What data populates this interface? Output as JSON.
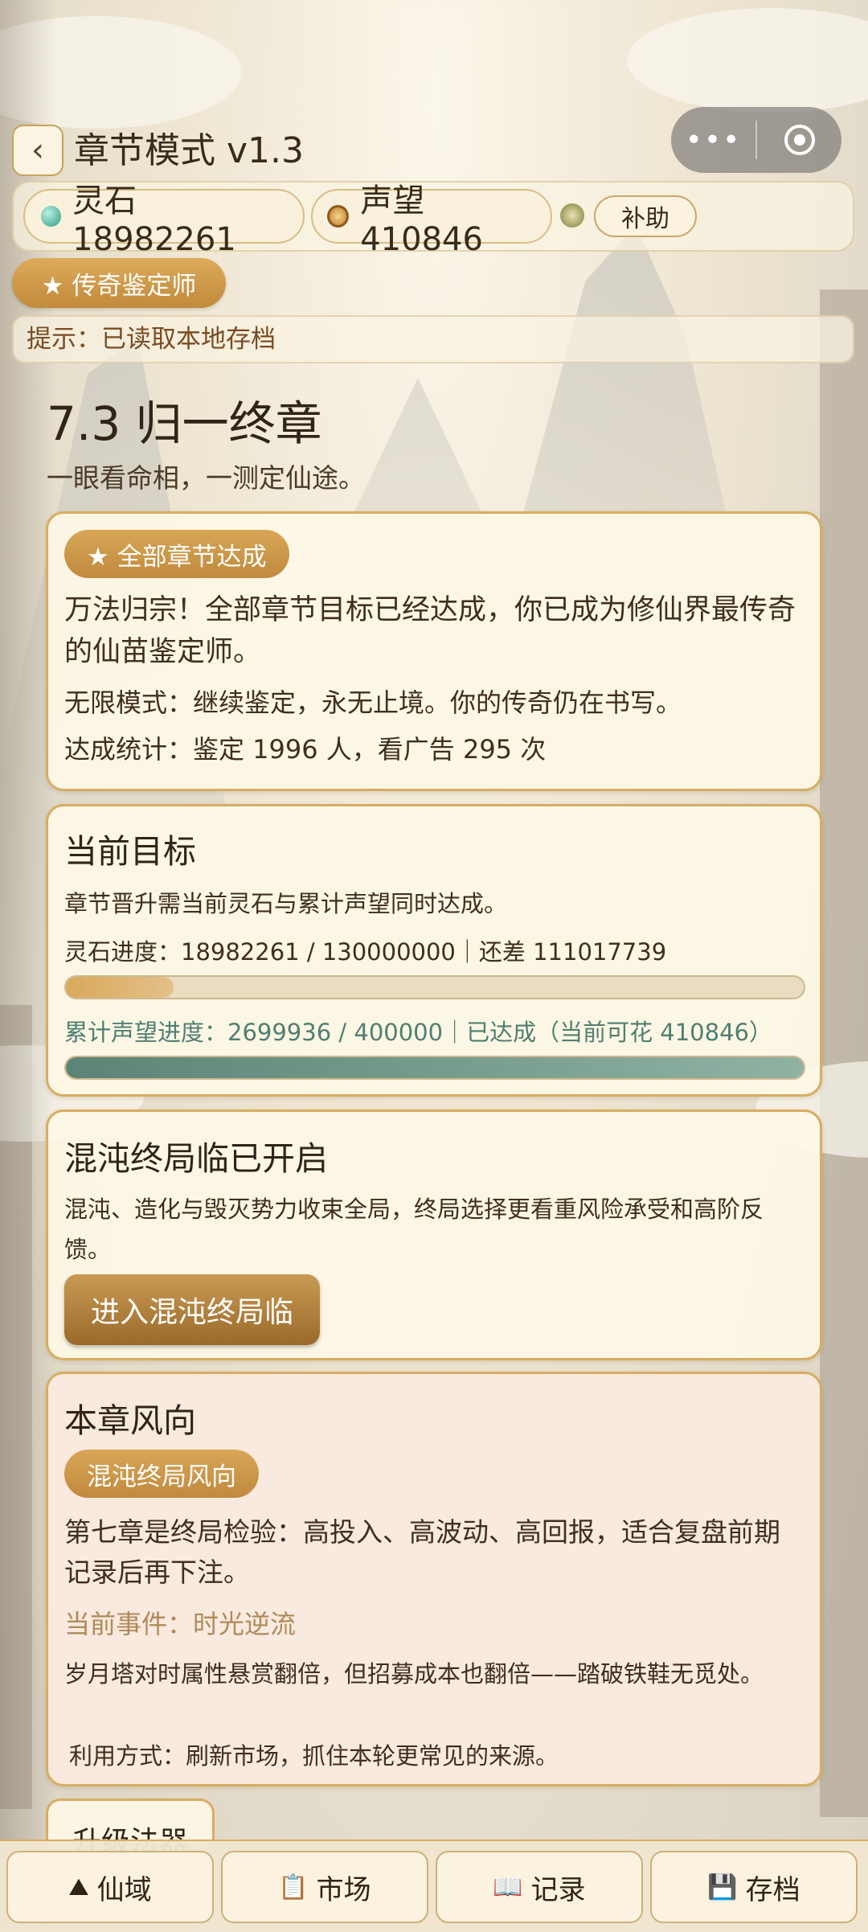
{
  "header": {
    "back_icon": "‹",
    "title": "章节模式 v1.3",
    "menu_dots": "•••"
  },
  "resources": {
    "spirit_stone": "灵石 18982261",
    "prestige": "声望 410846",
    "assist_label": "补助"
  },
  "title_badge": "★ 传奇鉴定师",
  "tip": "提示：已读取本地存档",
  "chapter": {
    "title": "7.3 归一终章",
    "subtitle": "一眼看命相，一测定仙途。"
  },
  "achievement_card": {
    "badge": "★ 全部章节达成",
    "main_text": "万法归宗！全部章节目标已经达成，你已成为修仙界最传奇的仙苗鉴定师。",
    "infinite_mode": "无限模式：继续鉴定，永无止境。你的传奇仍在书写。",
    "stats": "达成统计：鉴定 1996 人，看广告 295 次"
  },
  "goal_card": {
    "heading": "当前目标",
    "desc": "章节晋升需当前灵石与累计声望同时达成。",
    "stone_progress_text": "灵石进度：18982261 / 130000000｜还差 111017739",
    "stone_progress_value": 0.146,
    "prestige_progress_text": "累计声望进度：2699936 / 400000｜已达成（当前可花 410846）",
    "prestige_progress_value": 1.0
  },
  "chaos_card": {
    "heading": "混沌终局临已开启",
    "desc": "混沌、造化与毁灭势力收束全局，终局选择更看重风险承受和高阶反馈。",
    "button": "进入混沌终局临"
  },
  "trend_card": {
    "heading": "本章风向",
    "badge": "混沌终局风向",
    "desc": "第七章是终局检验：高投入、高波动、高回报，适合复盘前期记录后再下注。",
    "event": "当前事件：时光逆流",
    "event_desc": "岁月塔对时属性悬赏翻倍，但招募成本也翻倍——踏破铁鞋无觅处。",
    "usage": "利用方式：刷新市场，抓住本轮更常见的来源。"
  },
  "next_section_peek": "升级法器",
  "bottom_nav": [
    {
      "icon": "mountain-icon",
      "glyph": "⛰",
      "label": "仙域"
    },
    {
      "icon": "clipboard-icon",
      "glyph": "📋",
      "label": "市场"
    },
    {
      "icon": "book-icon",
      "glyph": "📖",
      "label": "记录"
    },
    {
      "icon": "floppy-disk-icon",
      "glyph": "💾",
      "label": "存档"
    }
  ],
  "colors": {
    "accent_gold": "#c8954a",
    "prestige_teal": "#4f7f72",
    "event_text": "#b08a5a",
    "tip_text": "#7a4b22"
  }
}
